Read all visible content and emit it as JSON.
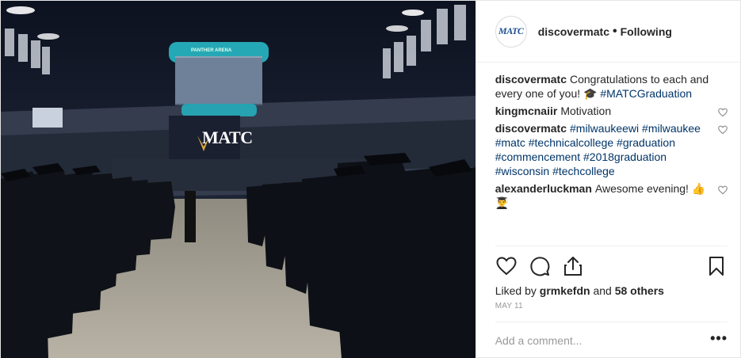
{
  "post": {
    "photo": {
      "sign_text": "MATC",
      "scoreboard_text": "PANTHER ARENA"
    },
    "header": {
      "avatar_text": "MATC",
      "username": "discovermatc",
      "dot": "•",
      "follow_status": "Following"
    },
    "comments": [
      {
        "user": "discovermatc",
        "parts": [
          {
            "text": "Congratulations to each and every one of you! ",
            "tag": false
          },
          {
            "text": "🎓",
            "tag": false
          },
          {
            "text": " ",
            "tag": false
          },
          {
            "text": "#MATCGraduation",
            "tag": true
          }
        ],
        "heart": false
      },
      {
        "user": "kingmcnaiir",
        "parts": [
          {
            "text": "Motivation",
            "tag": false
          }
        ],
        "heart": true
      },
      {
        "user": "discovermatc",
        "parts": [
          {
            "text": "#milwaukeewi",
            "tag": true
          },
          {
            "text": " ",
            "tag": false
          },
          {
            "text": "#milwaukee",
            "tag": true
          },
          {
            "text": " ",
            "tag": false
          },
          {
            "text": "#matc",
            "tag": true
          },
          {
            "text": " ",
            "tag": false
          },
          {
            "text": "#technicalcollege",
            "tag": true
          },
          {
            "text": " ",
            "tag": false
          },
          {
            "text": "#graduation",
            "tag": true
          },
          {
            "text": " ",
            "tag": false
          },
          {
            "text": "#commencement",
            "tag": true
          },
          {
            "text": " ",
            "tag": false
          },
          {
            "text": "#2018graduation",
            "tag": true
          },
          {
            "text": " ",
            "tag": false
          },
          {
            "text": "#wisconsin",
            "tag": true
          },
          {
            "text": " ",
            "tag": false
          },
          {
            "text": "#techcollege",
            "tag": true
          }
        ],
        "heart": true
      },
      {
        "user": "alexanderluckman",
        "parts": [
          {
            "text": "Awesome evening! ",
            "tag": false
          },
          {
            "text": "👍",
            "tag": false
          },
          {
            "text": " ",
            "tag": false
          },
          {
            "text": "👨‍🎓",
            "tag": false
          }
        ],
        "heart": true
      }
    ],
    "actions": {
      "icons": [
        "heart-icon",
        "comment-icon",
        "share-icon",
        "bookmark-icon"
      ]
    },
    "likes": {
      "prefix": "Liked by",
      "user": "grmkefdn",
      "middle": "and",
      "others": "58 others"
    },
    "date": "MAY 11",
    "add_comment": {
      "placeholder": "Add a comment...",
      "more_label": "•••"
    },
    "colors": {
      "hashtag": "#003569",
      "text": "#262626",
      "muted": "#999999",
      "border": "#efefef"
    }
  }
}
